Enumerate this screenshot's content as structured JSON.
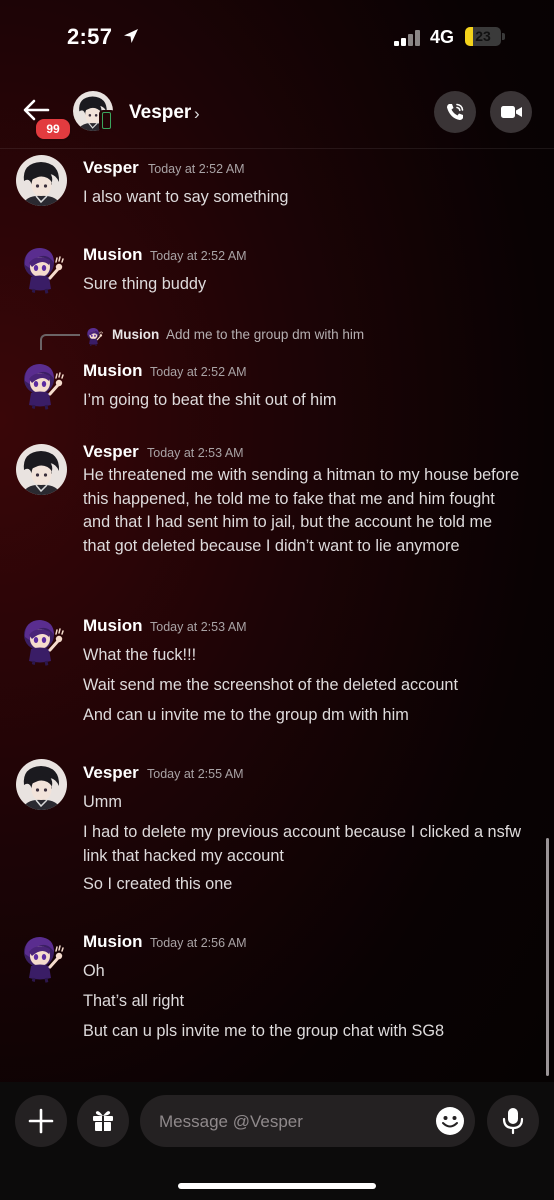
{
  "status": {
    "time": "2:57",
    "network": "4G",
    "battery": "23",
    "battery_level": 0.23
  },
  "header": {
    "badge": "99",
    "name": "Vesper",
    "chevron": "›"
  },
  "reply": {
    "name": "Musion",
    "text": "Add me to the group dm with him"
  },
  "messages": [
    {
      "author": "Vesper",
      "time": "Today at 2:52 AM",
      "lines": [
        "I also want to say something"
      ]
    },
    {
      "author": "Musion",
      "time": "Today at 2:52 AM",
      "lines": [
        "Sure thing buddy"
      ]
    },
    {
      "author": "Musion",
      "time": "Today at 2:52 AM",
      "lines": [
        "I’m going to beat the shit out of him"
      ]
    },
    {
      "author": "Vesper",
      "time": "Today at 2:53 AM",
      "lines": [
        "He threatened me with sending a hitman to my house before this happened, he told me to fake that me and him fought and that I had sent him to jail, but the account he told me that got deleted because I didn’t want to lie anymore"
      ]
    },
    {
      "author": "Musion",
      "time": "Today at 2:53 AM",
      "lines": [
        "What the fuck!!!",
        "Wait send me the screenshot of the deleted account",
        "And can u invite me to the group dm with him"
      ]
    },
    {
      "author": "Vesper",
      "time": "Today at 2:55 AM",
      "lines": [
        "Umm",
        "I had to delete my previous account because I clicked a nsfw link that hacked my account",
        "So I created this one"
      ]
    },
    {
      "author": "Musion",
      "time": "Today at 2:56 AM",
      "lines": [
        "Oh",
        "That’s all right",
        "But can u pls invite me to the group chat with SG8"
      ]
    }
  ],
  "input": {
    "placeholder": "Message @Vesper"
  },
  "icons": {
    "location": "location-arrow-icon",
    "signal": "signal-bars-icon",
    "battery": "battery-icon",
    "back": "back-arrow-icon",
    "mobile": "mobile-status-icon",
    "call": "phone-call-icon",
    "video": "video-camera-icon",
    "add": "plus-icon",
    "gift": "gift-icon",
    "emoji": "emoji-icon",
    "mic": "microphone-icon"
  },
  "colors": {
    "badge": "#e23b3f",
    "online": "#3ba55d",
    "battery": "#f4d31b",
    "background": "#1d0406"
  }
}
